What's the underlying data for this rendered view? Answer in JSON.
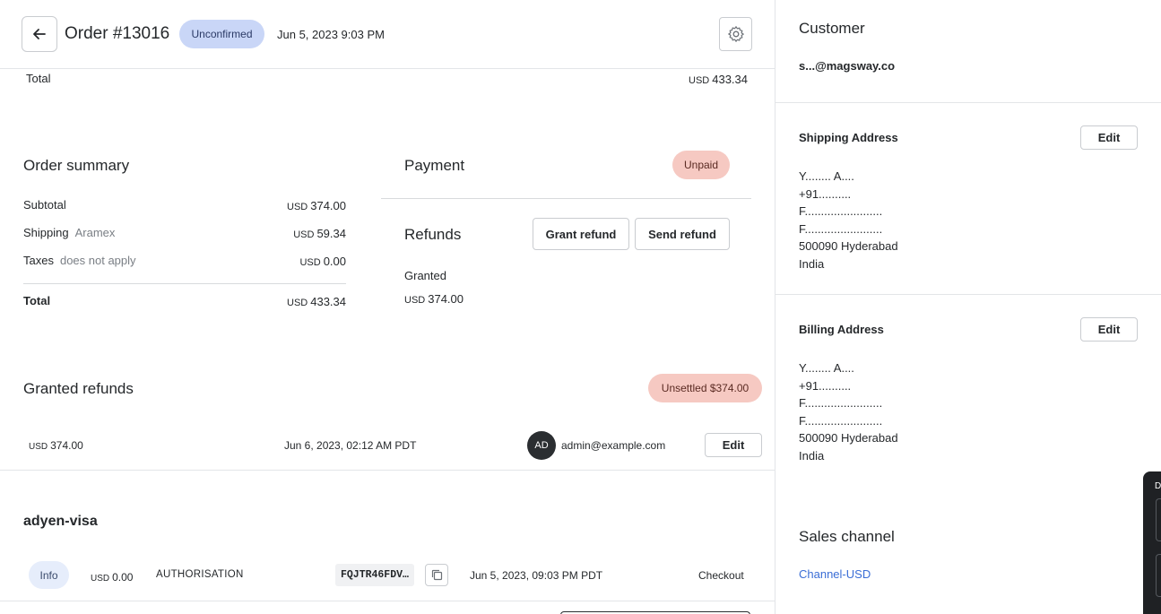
{
  "header": {
    "title": "Order #13016",
    "status_badge": "Unconfirmed",
    "date": "Jun 5, 2023 9:03 PM"
  },
  "top_total": {
    "label": "Total",
    "currency": "USD",
    "amount": "433.34"
  },
  "order_summary": {
    "title": "Order summary",
    "rows": [
      {
        "label": "Subtotal",
        "note": "",
        "currency": "USD",
        "amount": "374.00"
      },
      {
        "label": "Shipping",
        "note": "Aramex",
        "currency": "USD",
        "amount": "59.34"
      },
      {
        "label": "Taxes",
        "note": "does not apply",
        "currency": "USD",
        "amount": "0.00"
      }
    ],
    "total": {
      "label": "Total",
      "currency": "USD",
      "amount": "433.34"
    }
  },
  "payment": {
    "title": "Payment",
    "status": "Unpaid"
  },
  "refunds": {
    "title": "Refunds",
    "grant_label": "Grant refund",
    "send_label": "Send refund",
    "granted_label": "Granted",
    "granted_currency": "USD",
    "granted_amount": "374.00"
  },
  "granted_refunds": {
    "title": "Granted refunds",
    "unsettled_badge": "Unsettled $374.00",
    "row": {
      "currency": "USD",
      "amount": "374.00",
      "date": "Jun 6, 2023, 02:12 AM PDT",
      "avatar_initials": "AD",
      "user": "admin@example.com",
      "edit_label": "Edit"
    }
  },
  "transaction": {
    "title": "adyen-visa",
    "row": {
      "type_badge": "Info",
      "currency": "USD",
      "amount": "0.00",
      "event": "AUTHORISATION",
      "psp_ref": "FQJTR46FDV…",
      "date": "Jun 5, 2023, 09:03 PM PDT",
      "source": "Checkout"
    }
  },
  "sidebar": {
    "customer": {
      "title": "Customer",
      "email": "s...@magsway.co"
    },
    "shipping_address": {
      "title": "Shipping Address",
      "edit_label": "Edit",
      "lines": [
        "Y........ A....",
        "+91..........",
        "F........................",
        "F........................",
        "500090 Hyderabad",
        "India"
      ]
    },
    "billing_address": {
      "title": "Billing Address",
      "edit_label": "Edit",
      "lines": [
        "Y........ A....",
        "+91..........",
        "F........................",
        "F........................",
        "500090 Hyderabad",
        "India"
      ]
    },
    "sales_channel": {
      "title": "Sales channel",
      "link": "Channel-USD"
    },
    "floating_panel_letter": "D"
  },
  "colors": {
    "unconfirmed_bg": "#c9d6f7",
    "unpaid_bg": "#f6c9c2",
    "link": "#3b6ed6",
    "info_bg": "#e6edfb"
  }
}
